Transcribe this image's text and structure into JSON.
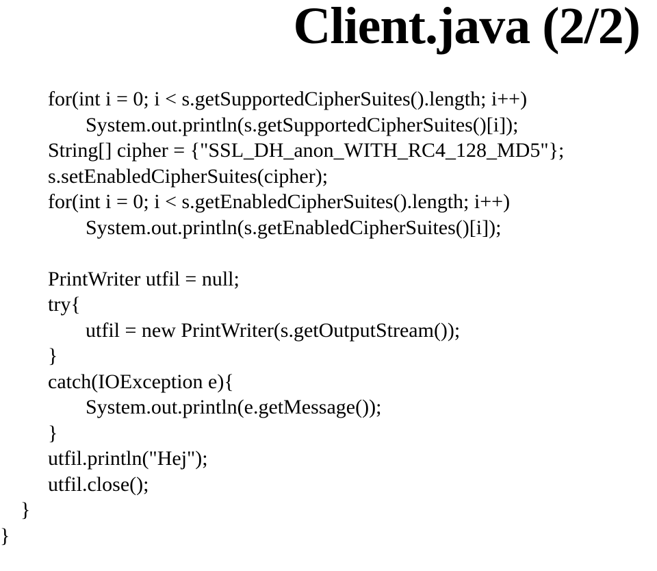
{
  "title": "Client.java (2/2)",
  "code": {
    "l1": "for(int i = 0; i < s.getSupportedCipherSuites().length; i++)",
    "l2": "System.out.println(s.getSupportedCipherSuites()[i]);",
    "l3": "String[] cipher = {\"SSL_DH_anon_WITH_RC4_128_MD5\"};",
    "l4": "s.setEnabledCipherSuites(cipher);",
    "l5": "for(int i = 0; i < s.getEnabledCipherSuites().length; i++)",
    "l6": "System.out.println(s.getEnabledCipherSuites()[i]);",
    "l7": "",
    "l8": "PrintWriter utfil = null;",
    "l9": "try{",
    "l10": "utfil = new PrintWriter(s.getOutputStream());",
    "l11": "}",
    "l12": "catch(IOException e){",
    "l13": "System.out.println(e.getMessage());",
    "l14": "}",
    "l15": "utfil.println(\"Hej\");",
    "l16": "utfil.close();",
    "l17": "}",
    "l18": "}"
  }
}
